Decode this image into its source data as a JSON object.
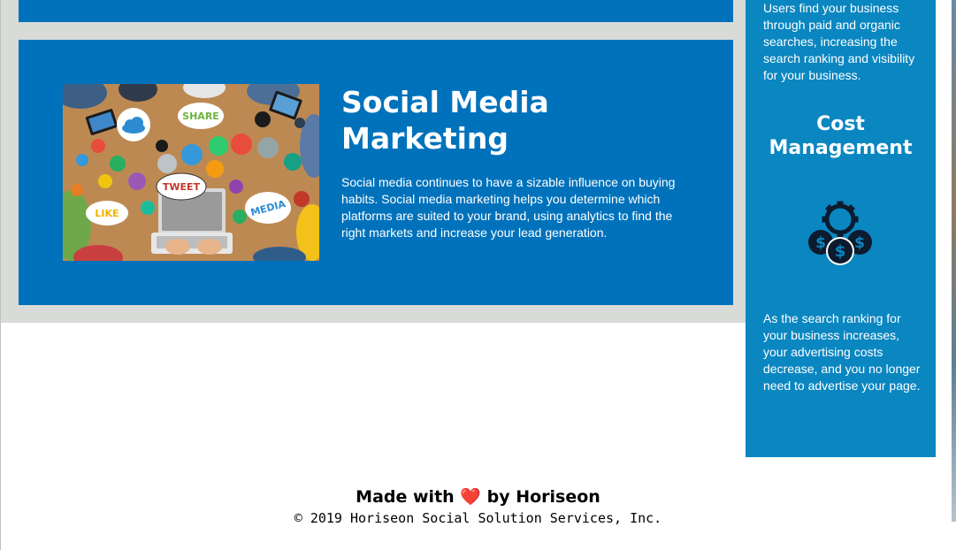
{
  "smm_card": {
    "title": "Social Media Marketing",
    "text": "Social media continues to have a sizable influence on buying habits. Social media marketing helps you determine which platforms are suited to your brand, using analytics to find the right markets and increase your lead generation.",
    "image_icons": [
      "share-bubble",
      "tweet-bubble",
      "like-bubble",
      "media-bubble",
      "cloud-icon",
      "camera-icon",
      "wifi-icon",
      "star-icon",
      "search-icon",
      "music-icon",
      "phone-icon",
      "robot-icon"
    ],
    "image_labels": {
      "share": "SHARE",
      "tweet": "TWEET",
      "like": "LIKE",
      "media": "MEDIA"
    }
  },
  "sidebar": {
    "top_text": "Users find your business through paid and organic searches, increasing the search ranking and visibility for your business.",
    "heading": "Cost Management",
    "icon": "cost-management-icon",
    "bottom_text": "As the search ranking for your business increases, your advertising costs decrease, and you no longer need to advertise your page."
  },
  "footer": {
    "made_with_prefix": "Made with",
    "heart": "❤️",
    "made_with_suffix": "by Horiseon",
    "copyright": "© 2019 Horiseon Social Solution Services, Inc."
  },
  "colors": {
    "card_blue": "#0072bb",
    "sidebar_blue": "#0a86c0",
    "content_gray": "#d9dbd8",
    "heart_red": "#e11d2a"
  }
}
